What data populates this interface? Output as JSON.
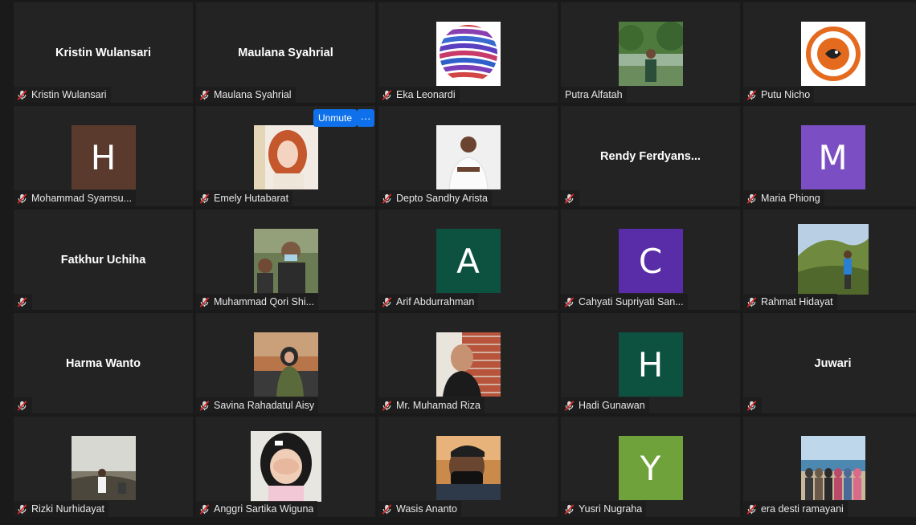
{
  "controls": {
    "unmute_label": "Unmute",
    "more_label": "···"
  },
  "participants": [
    {
      "name": "Kristin Wulansari",
      "display": "Kristin Wulansari",
      "type": "name"
    },
    {
      "name": "Maulana Syahrial",
      "display": "Maulana Syahrial",
      "type": "name"
    },
    {
      "name": "Eka Leonardi",
      "type": "photo",
      "photo": "logo-stripes"
    },
    {
      "name": "Putra Alfatah",
      "type": "photo",
      "photo": "forest-person",
      "unmuted": true
    },
    {
      "name": "Putu Nicho",
      "type": "photo",
      "photo": "logo-fish"
    },
    {
      "name": "Mohammad Syamsu...",
      "type": "letter",
      "letter": "H",
      "color": "#5b3a2e"
    },
    {
      "name": "Emely Hutabarat",
      "type": "photo",
      "photo": "woman-red-hair"
    },
    {
      "name": "Depto Sandhy Arista",
      "type": "photo",
      "photo": "man-white-shirt"
    },
    {
      "name": "",
      "display": "Rendy  Ferdyans...",
      "type": "name"
    },
    {
      "name": "Maria Phiong",
      "type": "letter",
      "letter": "M",
      "color": "#7b4fc3"
    },
    {
      "name": "",
      "display": "Fatkhur Uchiha",
      "type": "name"
    },
    {
      "name": "Muhammad Qori Shi...",
      "type": "photo",
      "photo": "boys-mask"
    },
    {
      "name": "Arif Abdurrahman",
      "type": "letter",
      "letter": "A",
      "color": "#0d5240"
    },
    {
      "name": "Cahyati Supriyati San...",
      "type": "letter",
      "letter": "C",
      "color": "#5a2da8"
    },
    {
      "name": "Rahmat Hidayat",
      "type": "photo",
      "photo": "hill-person",
      "wide": true
    },
    {
      "name": "",
      "display": "Harma Wanto",
      "type": "name"
    },
    {
      "name": "Savina Rahadatul Aisy",
      "type": "photo",
      "photo": "hijab-car"
    },
    {
      "name": "Mr. Muhamad Riza",
      "type": "photo",
      "photo": "man-brick"
    },
    {
      "name": "Hadi Gunawan",
      "type": "letter",
      "letter": "H",
      "color": "#0d5240"
    },
    {
      "name": "",
      "display": "Juwari",
      "type": "name"
    },
    {
      "name": "Rizki Nurhidayat",
      "type": "photo",
      "photo": "sunset-person"
    },
    {
      "name": "Anggri Sartika Wiguna",
      "type": "photo",
      "photo": "girl-hand",
      "wide": true
    },
    {
      "name": "Wasis Ananto",
      "type": "photo",
      "photo": "man-mask"
    },
    {
      "name": "Yusri Nugraha",
      "type": "letter",
      "letter": "Y",
      "color": "#6fa23a"
    },
    {
      "name": "era desti ramayani",
      "type": "photo",
      "photo": "beach-group"
    }
  ]
}
